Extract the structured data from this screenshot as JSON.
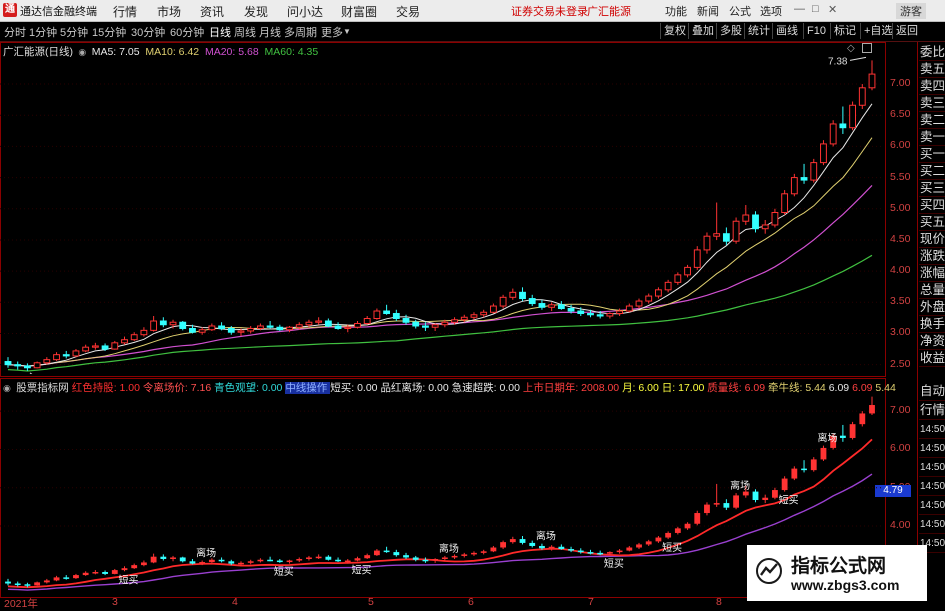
{
  "app": {
    "name": "通达信金融终端",
    "logo_glyph": "通"
  },
  "menu": [
    "行情",
    "市场",
    "资讯",
    "发现",
    "问小达",
    "财富圈",
    "交易"
  ],
  "status": {
    "login": "证券交易未登录",
    "stock": "广汇能源"
  },
  "title_buttons": [
    "功能",
    "新闻",
    "公式",
    "选项"
  ],
  "guest": "游客",
  "window_controls": {
    "minimize": "—",
    "maximize": "□",
    "close": "✕"
  },
  "timeframes": [
    "分时",
    "1分钟",
    "5分钟",
    "15分钟",
    "30分钟",
    "60分钟",
    "日线",
    "周线",
    "月线",
    "多周期",
    "更多"
  ],
  "active_timeframe": "日线",
  "right_toolbar": [
    "复权",
    "叠加",
    "多股",
    "统计",
    "画线",
    "F10",
    "标记",
    "+自选",
    "返回"
  ],
  "main_legend": {
    "stock_label": "广汇能源(日线)",
    "ma": [
      {
        "text": "MA5: 7.05",
        "color": "#e8e8e8"
      },
      {
        "text": "MA10: 6.42",
        "color": "#e0d070"
      },
      {
        "text": "MA20: 5.68",
        "color": "#d050d0"
      },
      {
        "text": "MA60: 4.35",
        "color": "#40c040"
      }
    ]
  },
  "price_axis": [
    "7.00",
    "6.50",
    "6.00",
    "5.50",
    "5.00",
    "4.50",
    "4.00",
    "3.50",
    "3.00",
    "2.50"
  ],
  "annotations": {
    "high": "7.38",
    "low": "2.40"
  },
  "sub_legend": {
    "name": "股票指标网",
    "items": [
      {
        "text": "红色持股: 1.00",
        "color": "#ff3030"
      },
      {
        "text": "令离场价: 7.16",
        "color": "#ff5050"
      },
      {
        "text": "青色观望: 0.00",
        "color": "#30d8d8"
      },
      {
        "text": "中线操作",
        "color": "#4070ff",
        "boxed": true
      },
      {
        "text": "短买: 0.00",
        "color": "#e8e8e8"
      },
      {
        "text": "品红离场: 0.00",
        "color": "#e8e8e8"
      },
      {
        "text": "急速超跌: 0.00",
        "color": "#e8e8e8"
      },
      {
        "text": "上市日期年: 2008.00",
        "color": "#ff4040"
      },
      {
        "text": "月: 6.00",
        "color": "#ffff40"
      },
      {
        "text": "日: 17.00",
        "color": "#ffff40"
      },
      {
        "text": "质量线: 6.09",
        "color": "#ff4040"
      },
      {
        "text": "牵牛线: 5.44",
        "color": "#e0d070"
      },
      {
        "text": "6.09",
        "color": "#e8e8e8"
      },
      {
        "text": "6.09",
        "color": "#ff4040"
      },
      {
        "text": "5.44",
        "color": "#e0d070"
      }
    ]
  },
  "sub_axis": [
    "7.00",
    "6.00",
    "5.00",
    "4.00"
  ],
  "sub_marker": "4.79",
  "side_tabs_top": [
    "委比",
    "卖五",
    "卖四",
    "卖三",
    "卖二",
    "卖一",
    "买一",
    "买二",
    "买三",
    "买四",
    "买五",
    "现价",
    "涨跌",
    "涨幅",
    "总量",
    "外盘",
    "换手",
    "净资",
    "收益"
  ],
  "side_tabs_bottom": [
    "自动",
    "行情",
    "14:50",
    "14:50",
    "14:50",
    "14:50",
    "14:50",
    "14:50",
    "14:50"
  ],
  "x_axis": [
    "2021年",
    "3",
    "4",
    "5",
    "6",
    "7",
    "8"
  ],
  "chart_labels": {
    "sell": "离场",
    "buy": "短买",
    "green": "高",
    "seesaw": "离场"
  },
  "watermark": {
    "title": "指标公式网",
    "url": "www.zbgs3.com"
  },
  "colors": {
    "up": "#ff3333",
    "down": "#33ffff",
    "ma5": "#e8e8e8",
    "ma10": "#e0d070",
    "ma20": "#d050d0",
    "ma60": "#40c040",
    "grid": "#8b0000"
  },
  "chart_data": {
    "type": "candlestick",
    "symbol": "广汇能源",
    "ylim": [
      2.35,
      7.45
    ],
    "candles": [
      [
        2.55,
        2.62,
        2.45,
        2.5
      ],
      [
        2.5,
        2.55,
        2.42,
        2.48
      ],
      [
        2.48,
        2.52,
        2.4,
        2.45
      ],
      [
        2.45,
        2.55,
        2.44,
        2.53
      ],
      [
        2.53,
        2.62,
        2.5,
        2.58
      ],
      [
        2.58,
        2.7,
        2.56,
        2.66
      ],
      [
        2.66,
        2.72,
        2.6,
        2.64
      ],
      [
        2.64,
        2.75,
        2.62,
        2.72
      ],
      [
        2.72,
        2.82,
        2.7,
        2.78
      ],
      [
        2.78,
        2.85,
        2.74,
        2.8
      ],
      [
        2.8,
        2.84,
        2.72,
        2.75
      ],
      [
        2.75,
        2.88,
        2.74,
        2.85
      ],
      [
        2.85,
        2.95,
        2.82,
        2.9
      ],
      [
        2.9,
        3.02,
        2.88,
        2.98
      ],
      [
        2.98,
        3.1,
        2.95,
        3.05
      ],
      [
        3.05,
        3.28,
        3.03,
        3.2
      ],
      [
        3.2,
        3.26,
        3.1,
        3.14
      ],
      [
        3.14,
        3.22,
        3.08,
        3.18
      ],
      [
        3.18,
        3.2,
        3.05,
        3.08
      ],
      [
        3.08,
        3.14,
        3.0,
        3.02
      ],
      [
        3.02,
        3.1,
        2.98,
        3.06
      ],
      [
        3.06,
        3.16,
        3.04,
        3.12
      ],
      [
        3.12,
        3.18,
        3.05,
        3.08
      ],
      [
        3.08,
        3.12,
        2.98,
        3.02
      ],
      [
        3.02,
        3.08,
        2.96,
        3.04
      ],
      [
        3.04,
        3.12,
        3.0,
        3.08
      ],
      [
        3.08,
        3.16,
        3.05,
        3.12
      ],
      [
        3.12,
        3.2,
        3.08,
        3.1
      ],
      [
        3.1,
        3.14,
        3.04,
        3.06
      ],
      [
        3.06,
        3.12,
        3.02,
        3.1
      ],
      [
        3.1,
        3.18,
        3.06,
        3.14
      ],
      [
        3.14,
        3.22,
        3.1,
        3.18
      ],
      [
        3.18,
        3.26,
        3.14,
        3.2
      ],
      [
        3.2,
        3.24,
        3.1,
        3.12
      ],
      [
        3.12,
        3.18,
        3.06,
        3.08
      ],
      [
        3.08,
        3.14,
        3.02,
        3.1
      ],
      [
        3.1,
        3.2,
        3.08,
        3.16
      ],
      [
        3.16,
        3.28,
        3.14,
        3.24
      ],
      [
        3.24,
        3.4,
        3.22,
        3.36
      ],
      [
        3.36,
        3.46,
        3.3,
        3.32
      ],
      [
        3.32,
        3.38,
        3.2,
        3.24
      ],
      [
        3.24,
        3.3,
        3.14,
        3.18
      ],
      [
        3.18,
        3.22,
        3.08,
        3.12
      ],
      [
        3.12,
        3.18,
        3.04,
        3.1
      ],
      [
        3.1,
        3.16,
        3.04,
        3.14
      ],
      [
        3.14,
        3.22,
        3.1,
        3.18
      ],
      [
        3.18,
        3.26,
        3.14,
        3.22
      ],
      [
        3.22,
        3.3,
        3.18,
        3.26
      ],
      [
        3.26,
        3.34,
        3.22,
        3.3
      ],
      [
        3.3,
        3.38,
        3.26,
        3.34
      ],
      [
        3.34,
        3.48,
        3.32,
        3.44
      ],
      [
        3.44,
        3.62,
        3.4,
        3.58
      ],
      [
        3.58,
        3.72,
        3.54,
        3.66
      ],
      [
        3.66,
        3.74,
        3.52,
        3.56
      ],
      [
        3.56,
        3.62,
        3.44,
        3.48
      ],
      [
        3.48,
        3.54,
        3.38,
        3.42
      ],
      [
        3.42,
        3.5,
        3.36,
        3.46
      ],
      [
        3.46,
        3.52,
        3.38,
        3.4
      ],
      [
        3.4,
        3.46,
        3.32,
        3.36
      ],
      [
        3.36,
        3.42,
        3.28,
        3.32
      ],
      [
        3.32,
        3.38,
        3.26,
        3.3
      ],
      [
        3.3,
        3.36,
        3.24,
        3.28
      ],
      [
        3.28,
        3.34,
        3.24,
        3.32
      ],
      [
        3.32,
        3.4,
        3.28,
        3.36
      ],
      [
        3.36,
        3.48,
        3.34,
        3.44
      ],
      [
        3.44,
        3.56,
        3.4,
        3.52
      ],
      [
        3.52,
        3.64,
        3.48,
        3.6
      ],
      [
        3.6,
        3.74,
        3.56,
        3.7
      ],
      [
        3.7,
        3.86,
        3.66,
        3.82
      ],
      [
        3.82,
        3.98,
        3.78,
        3.94
      ],
      [
        3.94,
        4.1,
        3.9,
        4.06
      ],
      [
        4.06,
        4.4,
        4.02,
        4.34
      ],
      [
        4.34,
        4.62,
        4.28,
        4.56
      ],
      [
        4.56,
        5.1,
        4.5,
        4.6
      ],
      [
        4.6,
        4.7,
        4.42,
        4.48
      ],
      [
        4.48,
        4.86,
        4.44,
        4.8
      ],
      [
        4.8,
        5.06,
        4.74,
        4.9
      ],
      [
        4.9,
        4.96,
        4.62,
        4.68
      ],
      [
        4.68,
        4.82,
        4.6,
        4.74
      ],
      [
        4.74,
        5.0,
        4.7,
        4.94
      ],
      [
        4.94,
        5.3,
        4.9,
        5.24
      ],
      [
        5.24,
        5.56,
        5.2,
        5.5
      ],
      [
        5.5,
        5.72,
        5.4,
        5.46
      ],
      [
        5.46,
        5.8,
        5.42,
        5.74
      ],
      [
        5.74,
        6.1,
        5.7,
        6.04
      ],
      [
        6.04,
        6.42,
        6.0,
        6.36
      ],
      [
        6.36,
        6.64,
        6.2,
        6.3
      ],
      [
        6.3,
        6.72,
        6.26,
        6.66
      ],
      [
        6.66,
        7.0,
        6.6,
        6.94
      ],
      [
        6.94,
        7.38,
        6.9,
        7.16
      ]
    ]
  }
}
